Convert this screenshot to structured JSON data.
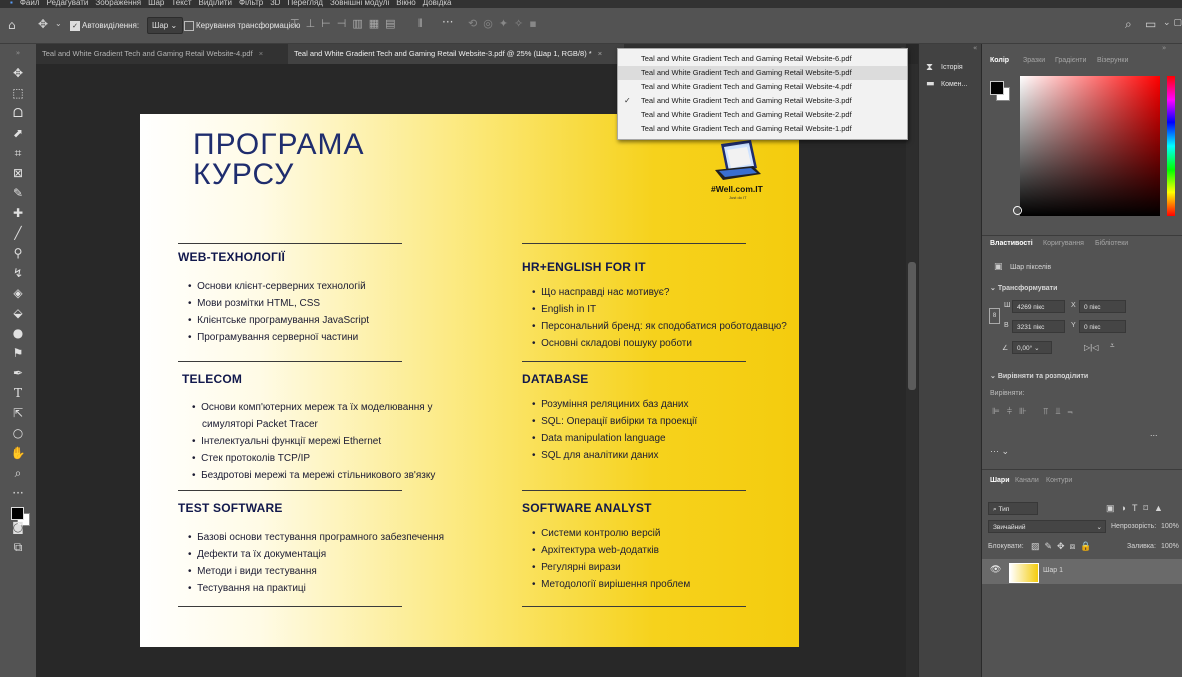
{
  "menu": [
    "Файл",
    "Редагувати",
    "Зображення",
    "Шар",
    "Текст",
    "Виділити",
    "Фільтр",
    "3D",
    "Перегляд",
    "Зовнішні модулі",
    "Вікно",
    "Довідка"
  ],
  "options": {
    "auto_select_label": "Автовиділення:",
    "auto_select_value": "Шар",
    "transform_controls_label": "Керування трансформацією"
  },
  "tabs": [
    {
      "label": "Teal and White Gradient Tech and Gaming Retail Website-4.pdf",
      "active": false
    },
    {
      "label": "Teal and White Gradient Tech and Gaming Retail Website-3.pdf @ 25% (Шар 1, RGB/8) *",
      "active": true
    }
  ],
  "tab_close": "×",
  "tab_overflow": "»",
  "dropdown": {
    "items": [
      {
        "label": "Teal and White Gradient Tech and Gaming Retail Website-6.pdf",
        "checked": false,
        "hover": false
      },
      {
        "label": "Teal and White Gradient Tech and Gaming Retail Website-5.pdf",
        "checked": false,
        "hover": true
      },
      {
        "label": "Teal and White Gradient Tech and Gaming Retail Website-4.pdf",
        "checked": false,
        "hover": false
      },
      {
        "label": "Teal and White Gradient Tech and Gaming Retail Website-3.pdf",
        "checked": true,
        "hover": false
      },
      {
        "label": "Teal and White Gradient Tech and Gaming Retail Website-2.pdf",
        "checked": false,
        "hover": false
      },
      {
        "label": "Teal and White Gradient Tech and Gaming Retail Website-1.pdf",
        "checked": false,
        "hover": false
      }
    ]
  },
  "document": {
    "title_line1": "ПРОГРАМА",
    "title_line2": "КУРСУ",
    "logo_text": "#Well.com.IT",
    "logo_sub": "Just do IT",
    "sections": [
      {
        "title": "WEB-ТЕХНОЛОГІЇ",
        "items": [
          "Основи клієнт-серверних технологій",
          "Мови розмітки HTML, CSS",
          "Клієнтське програмування JavaScript",
          "Програмування серверної частини"
        ]
      },
      {
        "title": "TELECOM",
        "items": [
          "Основи комп'ютерних мереж та їх моделювання у",
          "симуляторі Packet Tracer",
          "Інтелектуальні функції мережі Ethernet",
          "Стек протоколів TCP/IP",
          "Бездротові мережі та мережі стільникового зв'язку"
        ]
      },
      {
        "title": "TEST SOFTWARE",
        "items": [
          "Базові основи тестування програмного забезпечення",
          "Дефекти та їх документація",
          "Методи і види тестування",
          "Тестування на практиці"
        ]
      },
      {
        "title": "HR+ENGLISH FOR IT",
        "items": [
          "Що насправді нас мотивує?",
          "English in IT",
          "Персональний бренд: як сподобатися роботодавцю?",
          "Основні складові пошуку роботи"
        ]
      },
      {
        "title": "DATABASE",
        "items": [
          "Розуміння реляциних баз даних",
          "SQL: Операції вибірки та проекції",
          "Data manipulation language",
          "SQL для аналітики даних"
        ]
      },
      {
        "title": "SOFTWARE ANALYST",
        "items": [
          "Системи контролю версій",
          "Архітектура web-додатків",
          "Регулярні вирази",
          "Методології вирішення проблем"
        ]
      }
    ]
  },
  "midpanel": {
    "history": "Історія",
    "comments": "Комен..."
  },
  "color_panel": {
    "tabs": [
      "Колір",
      "Зразки",
      "Градієнти",
      "Візерунки"
    ]
  },
  "properties": {
    "tabs": [
      "Властивості",
      "Коригування",
      "Бібліотеки"
    ],
    "layer_type": "Шар пікселів",
    "transform_title": "Трансформувати",
    "w_label": "Ш",
    "w_value": "4269 пікс",
    "h_label": "В",
    "h_value": "3231 пікс",
    "x_label": "X",
    "x_value": "0 пікс",
    "y_label": "Y",
    "y_value": "0 пікс",
    "angle_value": "0,00°",
    "align_title": "Вирівняти та розподілити",
    "align_label": "Вирівняти:",
    "more": "..."
  },
  "layers": {
    "tabs": [
      "Шари",
      "Канали",
      "Контури"
    ],
    "filter_label": "Тип",
    "blend_mode": "Звичайний",
    "opacity_label": "Непрозорість:",
    "opacity_value": "100%",
    "lock_label": "Блокувати:",
    "fill_label": "Заливка:",
    "fill_value": "100%",
    "layer_name": "Шар 1"
  },
  "colors": {
    "accent_yellow": "#f4cc0e",
    "title_blue": "#1f2d6e",
    "panel_bg": "#535353"
  }
}
